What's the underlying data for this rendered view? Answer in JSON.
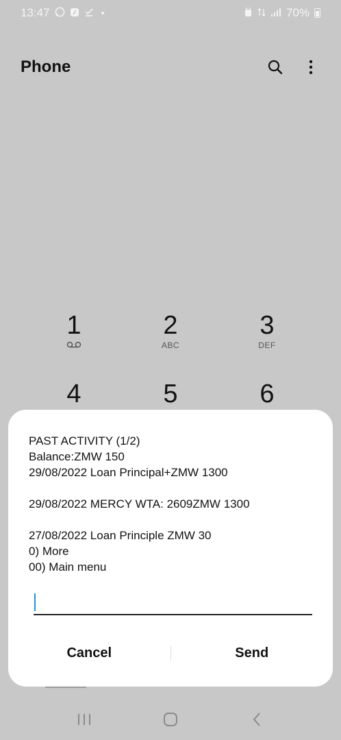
{
  "status_bar": {
    "time": "13:47",
    "battery": "70%",
    "icons": [
      "whatsapp-icon",
      "app-icon",
      "download-done-icon",
      "notification-dot",
      "alarm-icon",
      "signal-icon",
      "battery-icon"
    ]
  },
  "app_bar": {
    "title": "Phone",
    "icons": [
      "search-icon",
      "more-options-icon"
    ]
  },
  "dialpad": {
    "keys": [
      {
        "num": "1",
        "sub": ""
      },
      {
        "num": "2",
        "sub": "ABC"
      },
      {
        "num": "3",
        "sub": "DEF"
      },
      {
        "num": "4",
        "sub": ""
      },
      {
        "num": "5",
        "sub": ""
      },
      {
        "num": "6",
        "sub": ""
      }
    ]
  },
  "dialog": {
    "lines": [
      "PAST ACTIVITY (1/2)",
      "Balance:ZMW 150",
      "29/08/2022 Loan Principal+ZMW 1300",
      "",
      "29/08/2022 MERCY WTA: 2609ZMW 1300",
      "",
      "27/08/2022 Loan Principle ZMW 30",
      "0) More",
      "00) Main menu"
    ],
    "input_value": "",
    "cancel_label": "Cancel",
    "send_label": "Send",
    "accent": "#2b8ed6"
  },
  "nav_bar": {
    "icons": [
      "recent-apps-icon",
      "home-icon",
      "back-icon"
    ]
  }
}
